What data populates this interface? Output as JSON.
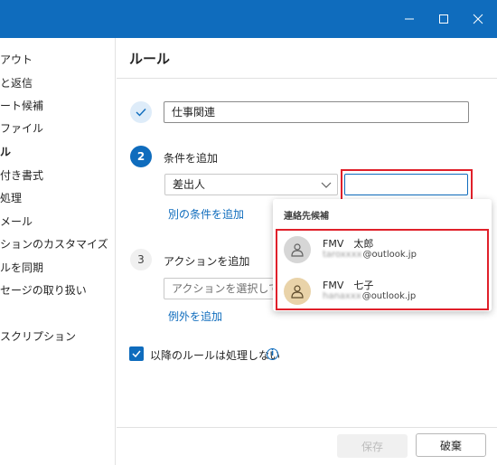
{
  "titlebar": {
    "color": "#0f6cbd"
  },
  "sidebar": {
    "items": [
      {
        "label": "アウト"
      },
      {
        "label": "と返信"
      },
      {
        "label": "ート候補"
      },
      {
        "label": "ファイル"
      },
      {
        "label": "ル",
        "active": true
      },
      {
        "label": "付き書式"
      },
      {
        "label": "処理"
      },
      {
        "label": "メール"
      },
      {
        "label": "ションのカスタマイズ"
      },
      {
        "label": "ルを同期"
      },
      {
        "label": "セージの取り扱い"
      },
      {
        "label": "スクリプション"
      }
    ]
  },
  "main": {
    "title": "ルール",
    "step1": {
      "rule_name": "仕事関連"
    },
    "step2": {
      "number": "2",
      "label": "条件を追加",
      "condition_select": "差出人",
      "add_condition_link": "別の条件を追加"
    },
    "step3": {
      "number": "3",
      "label": "アクションを追加",
      "action_placeholder": "アクションを選択してください",
      "add_exception_link": "例外を追加"
    },
    "stop_processing": {
      "label": "以降のルールは処理しない",
      "checked": true
    },
    "footer": {
      "save_label": "保存",
      "discard_label": "破棄"
    }
  },
  "suggestions": {
    "header": "連絡先候補",
    "contacts": [
      {
        "name": "FMV　太郎",
        "blurred": "taroxxxx",
        "domain": "@outlook.jp",
        "avatar_color": "#d6d6d6"
      },
      {
        "name": "FMV　七子",
        "blurred": "hanaxxx",
        "domain": "@outlook.jp",
        "avatar_color": "#e9d3a9"
      }
    ]
  },
  "colors": {
    "accent": "#0f6cbd",
    "highlight": "#e0202a"
  }
}
